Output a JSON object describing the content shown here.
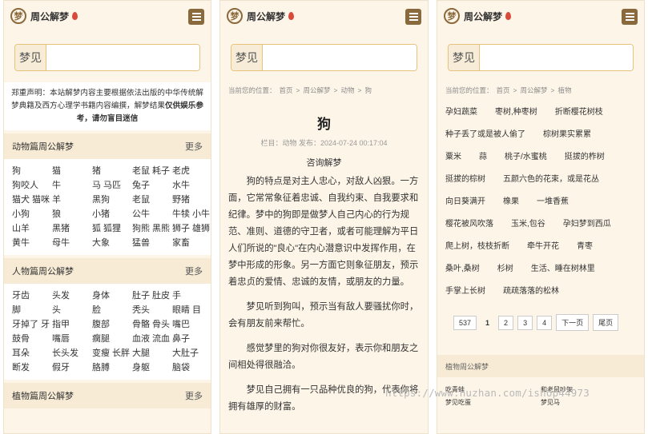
{
  "header": {
    "logo_glyph": "梦",
    "site_name": "周公解梦"
  },
  "search": {
    "label": "梦见",
    "placeholder": ""
  },
  "disclaimer": {
    "text": "郑重声明：本站解梦内容主要根据依法出版的中华传统解梦典籍及西方心理学书籍内容编撰，解梦结果",
    "bold": "仅供娱乐参考，请勿盲目迷信"
  },
  "more_label": "更多",
  "sections": [
    {
      "title": "动物篇周公解梦",
      "items": [
        "狗",
        "猫",
        "猪",
        "老鼠 耗子",
        "老虎",
        "狗咬人",
        "牛",
        "马 马匹",
        "兔子",
        "水牛",
        "猫犬 猫咪",
        "羊",
        "黑狗",
        "老鼠",
        "野猪",
        "小狗",
        "狼",
        "小猪",
        "公牛",
        "牛犊 小牛",
        "山羊",
        "黑猪",
        "狐 狐狸",
        "狗熊 黑熊",
        "狮子 雄狮",
        "黄牛",
        "母牛",
        "大象",
        "猛兽",
        "家畜"
      ]
    },
    {
      "title": "人物篇周公解梦",
      "items": [
        "牙齿",
        "头发",
        "身体",
        "肚子 肚皮",
        "手",
        "脚",
        "头",
        "脸",
        "秃头",
        "眼睛 目",
        "牙掉了 牙",
        "指甲",
        "腹部",
        "骨骼 骨头",
        "嘴巴",
        "鼓骨",
        "嘴唇",
        "瘸腿",
        "血液 流血",
        "鼻子",
        "耳朵",
        "长头发",
        "变瘦 长胖",
        "大腿",
        "大肚子",
        "断发",
        "假牙",
        "胳膊",
        "身躯",
        "脑袋"
      ]
    },
    {
      "title": "植物篇周公解梦",
      "items": []
    }
  ],
  "article": {
    "breadcrumb": [
      "当前您的位置：",
      "首页",
      ">",
      "周公解梦",
      ">",
      "动物",
      ">",
      "狗"
    ],
    "title": "狗",
    "meta": "栏目：动物 发布：2024-07-24 00:17:04",
    "category": "咨询解梦",
    "paragraphs": [
      "狗的特点是对主人忠心，对敌人凶狠。一方面，它常常象征着忠诚、自我约束、自我要求和纪律。梦中的狗即是做梦人自己内心的行为规范、准则、道德的守卫者，或者可能理解为平日人们所说的\"良心\"在内心潜意识中发挥作用，在梦中形成的形象。另一方面它则象征朋友，预示着忠贞的爱情、忠诚的友情，或朋友的力量。",
      "梦见听到狗叫，预示当有敌人要骚扰你时，会有朋友前来帮忙。",
      "感觉梦里的狗对你很友好，表示你和朋友之间相处得很融洽。",
      "梦见自己拥有一只品种优良的狗，代表你将拥有雄厚的财富。"
    ]
  },
  "plants": {
    "breadcrumb": [
      "当前您的位置：",
      "首页",
      ">",
      "周公解梦",
      ">",
      "植物"
    ],
    "tags": [
      "孕妇蔬菜",
      "枣树,种枣树",
      "折断樱花树枝",
      "种子丢了或是被人偷了",
      "棕树果实累累",
      "粟米",
      "蒜",
      "桃子/水蜜桃",
      "挺拔的柞树",
      "挺拔的棕树",
      "五颜六色的花束，或是花丛",
      "向日葵满开",
      "橡果",
      "一堆香蕉",
      "樱花被风吹落",
      "玉米,包谷",
      "孕妇梦到西瓜",
      "爬上树，枝枝折断",
      "牵牛开花",
      "青枣",
      "桑叶,桑树",
      "杉树",
      "生活、睡在树林里",
      "手掌上长树",
      "疏疏落落的松林"
    ],
    "pager": [
      "537",
      "1",
      "2",
      "3",
      "4",
      "下一页",
      "尾页"
    ],
    "related_head": "植物周公解梦",
    "related": [
      "吃青蛙",
      "和老鼠吵架",
      "梦见吃蛋",
      "梦见马"
    ]
  },
  "watermark": "https://www.huzhan.com/ishop44973",
  "colors": {
    "accent": "#8a6a3c",
    "border": "#e8c17a",
    "section_bg": "#f7ebd5",
    "panel_bg": "#fdf5e8"
  }
}
